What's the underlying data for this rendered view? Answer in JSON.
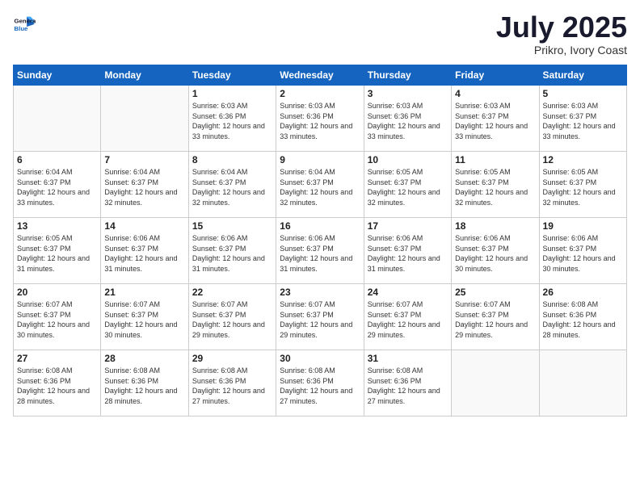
{
  "header": {
    "logo_line1": "General",
    "logo_line2": "Blue",
    "month": "July 2025",
    "location": "Prikro, Ivory Coast"
  },
  "weekdays": [
    "Sunday",
    "Monday",
    "Tuesday",
    "Wednesday",
    "Thursday",
    "Friday",
    "Saturday"
  ],
  "weeks": [
    [
      {
        "day": "",
        "empty": true
      },
      {
        "day": "",
        "empty": true
      },
      {
        "day": "1",
        "sunrise": "6:03 AM",
        "sunset": "6:36 PM",
        "daylight": "12 hours and 33 minutes."
      },
      {
        "day": "2",
        "sunrise": "6:03 AM",
        "sunset": "6:36 PM",
        "daylight": "12 hours and 33 minutes."
      },
      {
        "day": "3",
        "sunrise": "6:03 AM",
        "sunset": "6:36 PM",
        "daylight": "12 hours and 33 minutes."
      },
      {
        "day": "4",
        "sunrise": "6:03 AM",
        "sunset": "6:37 PM",
        "daylight": "12 hours and 33 minutes."
      },
      {
        "day": "5",
        "sunrise": "6:03 AM",
        "sunset": "6:37 PM",
        "daylight": "12 hours and 33 minutes."
      }
    ],
    [
      {
        "day": "6",
        "sunrise": "6:04 AM",
        "sunset": "6:37 PM",
        "daylight": "12 hours and 33 minutes."
      },
      {
        "day": "7",
        "sunrise": "6:04 AM",
        "sunset": "6:37 PM",
        "daylight": "12 hours and 32 minutes."
      },
      {
        "day": "8",
        "sunrise": "6:04 AM",
        "sunset": "6:37 PM",
        "daylight": "12 hours and 32 minutes."
      },
      {
        "day": "9",
        "sunrise": "6:04 AM",
        "sunset": "6:37 PM",
        "daylight": "12 hours and 32 minutes."
      },
      {
        "day": "10",
        "sunrise": "6:05 AM",
        "sunset": "6:37 PM",
        "daylight": "12 hours and 32 minutes."
      },
      {
        "day": "11",
        "sunrise": "6:05 AM",
        "sunset": "6:37 PM",
        "daylight": "12 hours and 32 minutes."
      },
      {
        "day": "12",
        "sunrise": "6:05 AM",
        "sunset": "6:37 PM",
        "daylight": "12 hours and 32 minutes."
      }
    ],
    [
      {
        "day": "13",
        "sunrise": "6:05 AM",
        "sunset": "6:37 PM",
        "daylight": "12 hours and 31 minutes."
      },
      {
        "day": "14",
        "sunrise": "6:06 AM",
        "sunset": "6:37 PM",
        "daylight": "12 hours and 31 minutes."
      },
      {
        "day": "15",
        "sunrise": "6:06 AM",
        "sunset": "6:37 PM",
        "daylight": "12 hours and 31 minutes."
      },
      {
        "day": "16",
        "sunrise": "6:06 AM",
        "sunset": "6:37 PM",
        "daylight": "12 hours and 31 minutes."
      },
      {
        "day": "17",
        "sunrise": "6:06 AM",
        "sunset": "6:37 PM",
        "daylight": "12 hours and 31 minutes."
      },
      {
        "day": "18",
        "sunrise": "6:06 AM",
        "sunset": "6:37 PM",
        "daylight": "12 hours and 30 minutes."
      },
      {
        "day": "19",
        "sunrise": "6:06 AM",
        "sunset": "6:37 PM",
        "daylight": "12 hours and 30 minutes."
      }
    ],
    [
      {
        "day": "20",
        "sunrise": "6:07 AM",
        "sunset": "6:37 PM",
        "daylight": "12 hours and 30 minutes."
      },
      {
        "day": "21",
        "sunrise": "6:07 AM",
        "sunset": "6:37 PM",
        "daylight": "12 hours and 30 minutes."
      },
      {
        "day": "22",
        "sunrise": "6:07 AM",
        "sunset": "6:37 PM",
        "daylight": "12 hours and 29 minutes."
      },
      {
        "day": "23",
        "sunrise": "6:07 AM",
        "sunset": "6:37 PM",
        "daylight": "12 hours and 29 minutes."
      },
      {
        "day": "24",
        "sunrise": "6:07 AM",
        "sunset": "6:37 PM",
        "daylight": "12 hours and 29 minutes."
      },
      {
        "day": "25",
        "sunrise": "6:07 AM",
        "sunset": "6:37 PM",
        "daylight": "12 hours and 29 minutes."
      },
      {
        "day": "26",
        "sunrise": "6:08 AM",
        "sunset": "6:36 PM",
        "daylight": "12 hours and 28 minutes."
      }
    ],
    [
      {
        "day": "27",
        "sunrise": "6:08 AM",
        "sunset": "6:36 PM",
        "daylight": "12 hours and 28 minutes."
      },
      {
        "day": "28",
        "sunrise": "6:08 AM",
        "sunset": "6:36 PM",
        "daylight": "12 hours and 28 minutes."
      },
      {
        "day": "29",
        "sunrise": "6:08 AM",
        "sunset": "6:36 PM",
        "daylight": "12 hours and 27 minutes."
      },
      {
        "day": "30",
        "sunrise": "6:08 AM",
        "sunset": "6:36 PM",
        "daylight": "12 hours and 27 minutes."
      },
      {
        "day": "31",
        "sunrise": "6:08 AM",
        "sunset": "6:36 PM",
        "daylight": "12 hours and 27 minutes."
      },
      {
        "day": "",
        "empty": true
      },
      {
        "day": "",
        "empty": true
      }
    ]
  ],
  "labels": {
    "sunrise_prefix": "Sunrise: ",
    "sunset_prefix": "Sunset: ",
    "daylight_prefix": "Daylight: "
  }
}
